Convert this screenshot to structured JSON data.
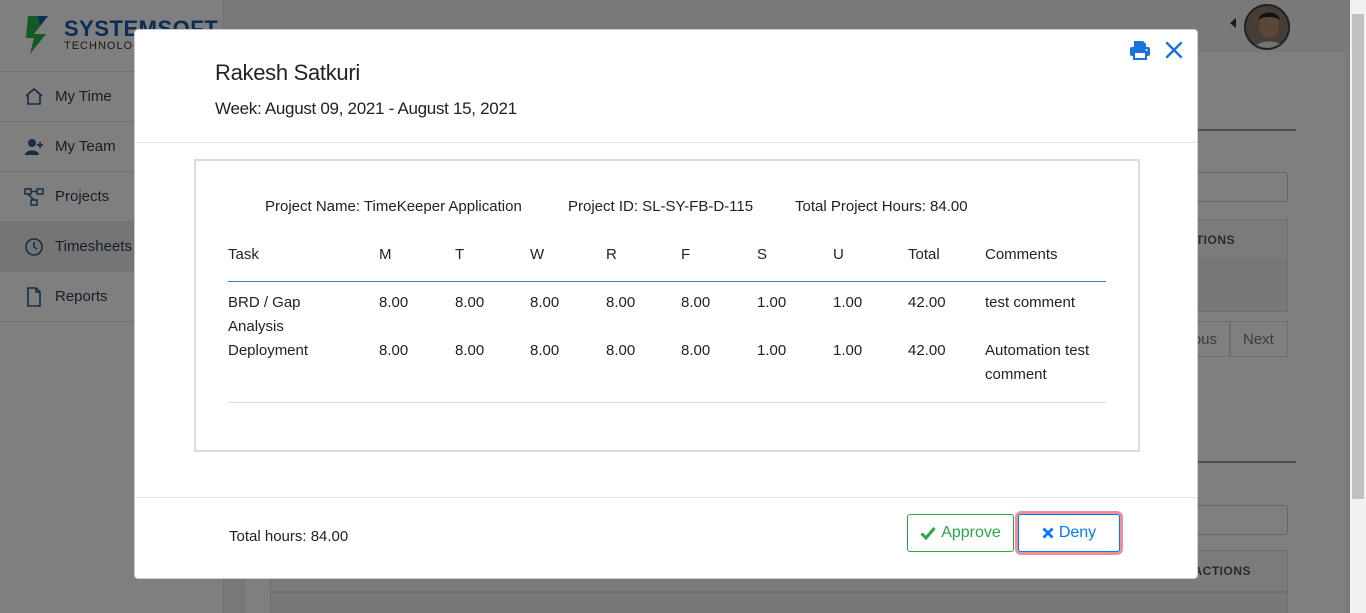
{
  "brand": {
    "name_part1": "SYSTEM",
    "name_part2": "SOFT",
    "subtitle": "TECHNOLOG"
  },
  "sidebar": {
    "items": [
      {
        "label": "My Time",
        "icon": "home-icon"
      },
      {
        "label": "My Team",
        "icon": "user-plus-icon"
      },
      {
        "label": "Projects",
        "icon": "project-diagram-icon"
      },
      {
        "label": "Timesheets",
        "icon": "clock-icon",
        "active": true
      },
      {
        "label": "Reports",
        "icon": "document-icon"
      }
    ]
  },
  "background": {
    "actions_header_1": "TIONS",
    "actions_header_2": "ACTIONS",
    "pager_prev": "ous",
    "pager_next": "Next"
  },
  "modal": {
    "employee_name": "Rakesh Satkuri",
    "week": "Week: August 09, 2021 - August 15, 2021",
    "project_name": "Project Name: TimeKeeper Application",
    "project_id": "Project ID: SL-SY-FB-D-115",
    "project_total": "Total Project Hours: 84.00",
    "columns": [
      "Task",
      "M",
      "T",
      "W",
      "R",
      "F",
      "S",
      "U",
      "Total",
      "Comments"
    ],
    "rows": [
      {
        "task_line1": "BRD / Gap",
        "task_line2": "Analysis",
        "M": "8.00",
        "T": "8.00",
        "W": "8.00",
        "R": "8.00",
        "F": "8.00",
        "S": "1.00",
        "U": "1.00",
        "total": "42.00",
        "comment_line1": "test comment",
        "comment_line2": ""
      },
      {
        "task_line1": "Deployment",
        "task_line2": "",
        "M": "8.00",
        "T": "8.00",
        "W": "8.00",
        "R": "8.00",
        "F": "8.00",
        "S": "1.00",
        "U": "1.00",
        "total": "42.00",
        "comment_line1": "Automation test",
        "comment_line2": "comment"
      }
    ],
    "total_hours": "Total hours: 84.00",
    "approve_label": "Approve",
    "deny_label": "Deny"
  },
  "colors": {
    "primary": "#007bff",
    "success": "#28a745",
    "danger_focus": "#dc3545",
    "brand_blue": "#1a5aa8",
    "brand_green": "#2bb34b"
  }
}
